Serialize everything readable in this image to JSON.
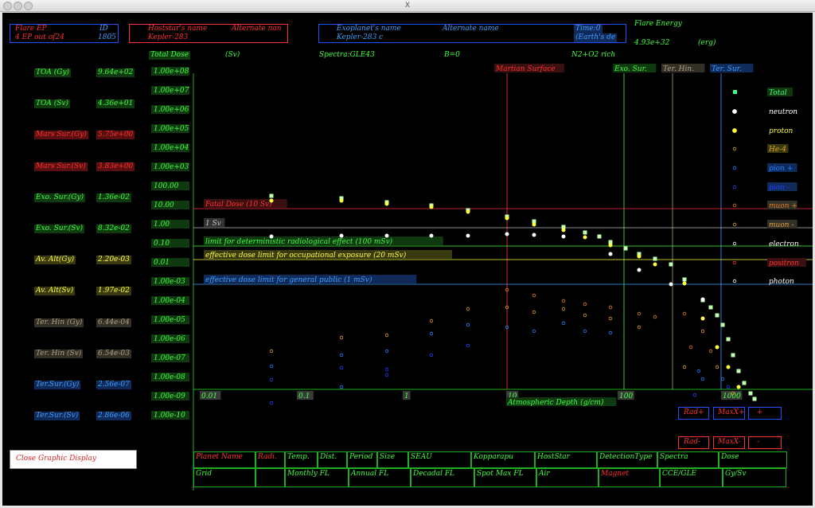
{
  "window": {
    "title": "X"
  },
  "header": {
    "flare_ep_label": "Flare EP",
    "ep_count_text": "4   EP out of24",
    "id_label": "ID",
    "id_value": "1805",
    "hoststar_label": "Hoststar's name",
    "hoststar_alt_label": "Alternate nan",
    "hoststar_name": "Kepler-283",
    "exoplanet_label": "Exoplanet's name",
    "exoplanet_alt_label": "Alternate name",
    "exoplanet_name": "Kepler-283 c",
    "time_label": "Time:0",
    "time_sub": "(Earth's de",
    "flare_energy_label": "Flare Energy",
    "flare_energy_value": "4.93e+32",
    "flare_energy_unit": "(erg)"
  },
  "info_row": {
    "total_dose": "Total Dose",
    "unit": "(Sv)",
    "spectra": "Spectra:GLE43",
    "b_value": "B=0",
    "atmosphere": "N2+O2 rich"
  },
  "left_panel": [
    {
      "label": "TOA (Gy)",
      "value": "9.64e+02",
      "color": "green"
    },
    {
      "label": "TOA (Sv)",
      "value": "4.36e+01",
      "color": "green"
    },
    {
      "label": "Mars Sur.(Gy)",
      "value": "5.75e+00",
      "color": "red"
    },
    {
      "label": "Mars Sur.(Sv)",
      "value": "3.83e+00",
      "color": "red"
    },
    {
      "label": "Exo. Sur.(Gy)",
      "value": "1.36e-02",
      "color": "green"
    },
    {
      "label": "Exo. Sur.(Sv)",
      "value": "8.32e-02",
      "color": "green"
    },
    {
      "label": "Av. Alt(Gy)",
      "value": "2.20e-03",
      "color": "yellow"
    },
    {
      "label": "Av. Alt(Sv)",
      "value": "1.97e-02",
      "color": "yellow"
    },
    {
      "label": "Ter. Hin (Gy)",
      "value": "6.44e-04",
      "color": "grey"
    },
    {
      "label": "Ter. Hin (Sv)",
      "value": "6.54e-03",
      "color": "grey"
    },
    {
      "label": "Ter.Sur.(Gy)",
      "value": "2.56e-07",
      "color": "blue"
    },
    {
      "label": "Ter.Sur.(Sv)",
      "value": "2.86e-06",
      "color": "blue"
    }
  ],
  "close_button": "Close Graphic Display",
  "plot_markers": [
    {
      "label": "Martian Surface",
      "color": "#ff3030"
    },
    {
      "label": "Exo. Sur.",
      "color": "#40ff40"
    },
    {
      "label": "Ter. Hin.",
      "color": "#b0a080"
    },
    {
      "label": "Ter. Sur.",
      "color": "#40a0ff"
    }
  ],
  "legend": [
    {
      "name": "Total",
      "color": "#40ff80"
    },
    {
      "name": "neutron",
      "color": "#ffffff"
    },
    {
      "name": "proton",
      "color": "#ffff40"
    },
    {
      "name": "He-4",
      "color": "#e0a020"
    },
    {
      "name": "pion +",
      "color": "#2080ff"
    },
    {
      "name": "pion -",
      "color": "#2040ff"
    },
    {
      "name": "muon +",
      "color": "#e08020"
    },
    {
      "name": "muon -",
      "color": "#e0a040"
    },
    {
      "name": "electron",
      "color": "#ffffff"
    },
    {
      "name": "positron",
      "color": "#ff3030"
    },
    {
      "name": "photon",
      "color": "#ffffff"
    }
  ],
  "dose_lines": [
    {
      "label": "Fatal Dose (10 Sv)",
      "color": "#ff3030",
      "y": 10
    },
    {
      "label": "1 Sv",
      "color": "#c0c0c0",
      "y": 1
    },
    {
      "label": "limit for deterministic radiological effect (100 mSv)",
      "color": "#40ff40",
      "y": 0.1
    },
    {
      "label": "effective dose limit for occupational exposure (20 mSv)",
      "color": "#ffff40",
      "y": 0.02
    },
    {
      "label": "effective dose limit for general public (1 mSv)",
      "color": "#40a0ff",
      "y": 0.001
    }
  ],
  "chart_data": {
    "type": "scatter",
    "xlabel": "Atmospheric Depth (g/cm)",
    "x_scale": "log",
    "y_scale": "log",
    "xlim": [
      0.01,
      1000
    ],
    "ylim": [
      1e-10,
      100000000.0
    ],
    "x_tick_labels": [
      "0.01",
      "0.1",
      "1",
      "10",
      "100",
      "1000"
    ],
    "y_tick_labels": [
      "1.00e+08",
      "1.00e+07",
      "1.00e+06",
      "1.00e+05",
      "1.00e+04",
      "1.00e+03",
      "100.00",
      "10.00",
      "1.00",
      "0.10",
      "0.01",
      "1.00e-03",
      "1.00e-04",
      "1.00e-05",
      "1.00e-06",
      "1.00e-07",
      "1.00e-08",
      "1.00e-09",
      "1.00e-10"
    ],
    "vertical_markers": [
      8.5,
      130,
      400,
      1033
    ],
    "series": [
      {
        "name": "Total",
        "x": [
          0.07,
          0.2,
          0.55,
          1.5,
          4,
          10,
          18,
          32,
          55,
          75,
          100,
          140,
          180,
          250,
          330,
          420,
          480,
          550,
          600,
          650,
          700,
          760,
          820,
          880,
          950,
          1000
        ],
        "y": [
          6,
          4.5,
          3.2,
          2.2,
          1.4,
          0.8,
          0.5,
          0.32,
          0.2,
          0.13,
          0.1,
          0.045,
          0.025,
          0.009,
          0.003,
          0.0012,
          0.0006,
          0.00025,
          0.0001,
          4e-05,
          1.5e-05,
          6e-06,
          2.5e-06,
          1e-06,
          4e-07,
          1.6e-07
        ]
      },
      {
        "name": "neutron",
        "x": [
          0.07,
          0.2,
          0.55,
          1.5,
          4,
          10,
          18,
          32,
          55,
          100,
          180,
          330
        ],
        "y": [
          0.3,
          0.3,
          0.3,
          0.3,
          0.3,
          0.32,
          0.3,
          0.25,
          0.15,
          0.06,
          0.02,
          0.006
        ]
      },
      {
        "name": "proton",
        "x": [
          0.07,
          0.2,
          0.55,
          1.5,
          4,
          10,
          18,
          32,
          55,
          100,
          180,
          330,
          480,
          600,
          700,
          820
        ],
        "y": [
          5,
          4,
          3,
          2,
          1.2,
          0.7,
          0.42,
          0.25,
          0.14,
          0.05,
          0.015,
          0.002,
          0.0003,
          5e-05,
          1e-05,
          1.5e-06
        ]
      },
      {
        "name": "He-4",
        "x": [
          0.07,
          0.2,
          0.55,
          1.5,
          4,
          10,
          18,
          32,
          55,
          100
        ],
        "y": [
          4e-07,
          5e-07,
          6e-07,
          8e-07,
          1e-06,
          1.5e-06,
          2.5e-06,
          4e-06,
          6e-06,
          8e-06
        ]
      },
      {
        "name": "pion +",
        "x": [
          0.07,
          0.2,
          0.55,
          1.5,
          4,
          10,
          18,
          32,
          55,
          100
        ],
        "y": [
          3e-08,
          5e-08,
          8e-08,
          1.2e-07,
          2e-07,
          4e-07,
          6e-07,
          8e-07,
          1e-06,
          1.2e-06
        ]
      },
      {
        "name": "muon +",
        "x": [
          4,
          10,
          18,
          32,
          55,
          100,
          180
        ],
        "y": [
          3e-05,
          5e-05,
          8e-05,
          0.0001,
          0.00012,
          8e-05,
          4e-05
        ]
      }
    ]
  },
  "bottom_buttons": {
    "rad_plus": "Rad+",
    "maxx_plus": "MaxX+",
    "plus": "+",
    "rad_minus": "Rad-",
    "maxx_minus": "MaxX-",
    "minus": "-"
  },
  "bottom_table": {
    "row1": [
      "Planet Name",
      "Radi.",
      "Temp.",
      "Dist.",
      "Period",
      "Size",
      "SEAU",
      "Kopparapu",
      "HostStar",
      "DetectionType",
      "Spectra",
      "Dose"
    ],
    "row2": [
      "Grid",
      "",
      "Monthly FL",
      "Annual FL",
      "Decadal FL",
      "Spot Max FL",
      "Air",
      "Magnet",
      "CCE/GLE",
      "Gy/Sv"
    ]
  }
}
